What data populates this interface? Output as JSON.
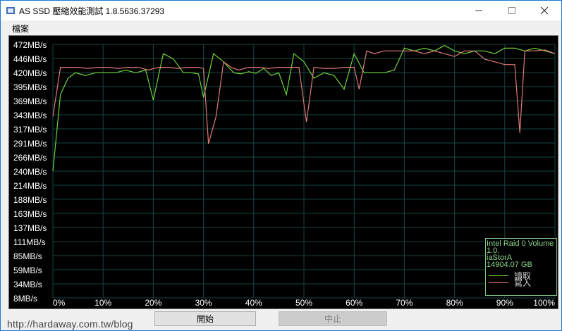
{
  "window": {
    "title": "AS SSD 壓縮效能測試 1.8.5636.37293"
  },
  "menu": {
    "file": "檔案"
  },
  "chart_data": {
    "type": "line",
    "title": "",
    "xlabel": "",
    "ylabel": "",
    "xlim": [
      0,
      100
    ],
    "ylim": [
      8,
      472
    ],
    "grid": true,
    "y_ticks": [
      "472MB/s",
      "446MB/s",
      "420MB/s",
      "395MB/s",
      "369MB/s",
      "343MB/s",
      "317MB/s",
      "291MB/s",
      "266MB/s",
      "240MB/s",
      "214MB/s",
      "188MB/s",
      "163MB/s",
      "137MB/s",
      "111MB/s",
      "85MB/s",
      "59MB/s",
      "34MB/s",
      "8MB/s"
    ],
    "x_ticks": [
      "0%",
      "10%",
      "20%",
      "30%",
      "40%",
      "50%",
      "60%",
      "70%",
      "80%",
      "90%",
      "100%"
    ],
    "series": [
      {
        "name": "讀取",
        "color": "#6cd33a",
        "x": [
          0,
          1.5,
          3,
          4.5,
          6.5,
          8.5,
          10.5,
          12.5,
          14.5,
          16.5,
          18.5,
          20,
          22,
          24,
          26,
          27.5,
          29,
          30,
          32,
          34,
          36,
          37.5,
          39,
          40.5,
          42,
          43.5,
          45,
          46.5,
          48,
          50,
          52,
          54,
          56,
          58,
          60,
          62,
          64,
          66,
          68,
          70,
          72,
          74,
          76,
          78,
          80,
          82,
          84,
          86,
          88,
          90,
          92,
          94,
          96,
          98,
          100
        ],
        "y": [
          240,
          380,
          410,
          420,
          415,
          420,
          420,
          420,
          425,
          420,
          425,
          370,
          455,
          445,
          420,
          420,
          418,
          375,
          455,
          440,
          420,
          418,
          422,
          419,
          428,
          415,
          420,
          380,
          455,
          440,
          410,
          420,
          415,
          390,
          455,
          420,
          420,
          420,
          425,
          465,
          460,
          465,
          460,
          470,
          460,
          455,
          460,
          460,
          455,
          465,
          465,
          460,
          465,
          460,
          455
        ]
      },
      {
        "name": "寫入",
        "color": "#e07a7a",
        "x": [
          0,
          1.5,
          3,
          5,
          7,
          9,
          11,
          13,
          15,
          17,
          19,
          21,
          23,
          25,
          27,
          29,
          30,
          31,
          32.5,
          34,
          35.5,
          37,
          39,
          41,
          43,
          45,
          47,
          49,
          50.5,
          52,
          54,
          56,
          58,
          60,
          61,
          62.5,
          64,
          66,
          68,
          70,
          72,
          74,
          76,
          78,
          80,
          82,
          84,
          86,
          88,
          90,
          92,
          93,
          94,
          96,
          98,
          100
        ],
        "y": [
          340,
          430,
          430,
          430,
          428,
          430,
          430,
          428,
          430,
          430,
          425,
          430,
          430,
          428,
          430,
          430,
          428,
          290,
          340,
          440,
          430,
          425,
          430,
          430,
          428,
          430,
          430,
          430,
          330,
          430,
          428,
          428,
          430,
          430,
          390,
          460,
          455,
          460,
          460,
          460,
          460,
          455,
          460,
          455,
          450,
          460,
          460,
          445,
          440,
          435,
          435,
          310,
          460,
          460,
          462,
          455
        ]
      }
    ]
  },
  "legend": {
    "device": "Intel Raid 0 Volume",
    "line2": "1.0.",
    "driver": "iaStorA",
    "capacity": "14904.07 GB",
    "read": "讀取",
    "write": "寫入"
  },
  "buttons": {
    "start": "開始",
    "stop": "中止"
  },
  "watermark": "http://hardaway.com.tw/blog"
}
